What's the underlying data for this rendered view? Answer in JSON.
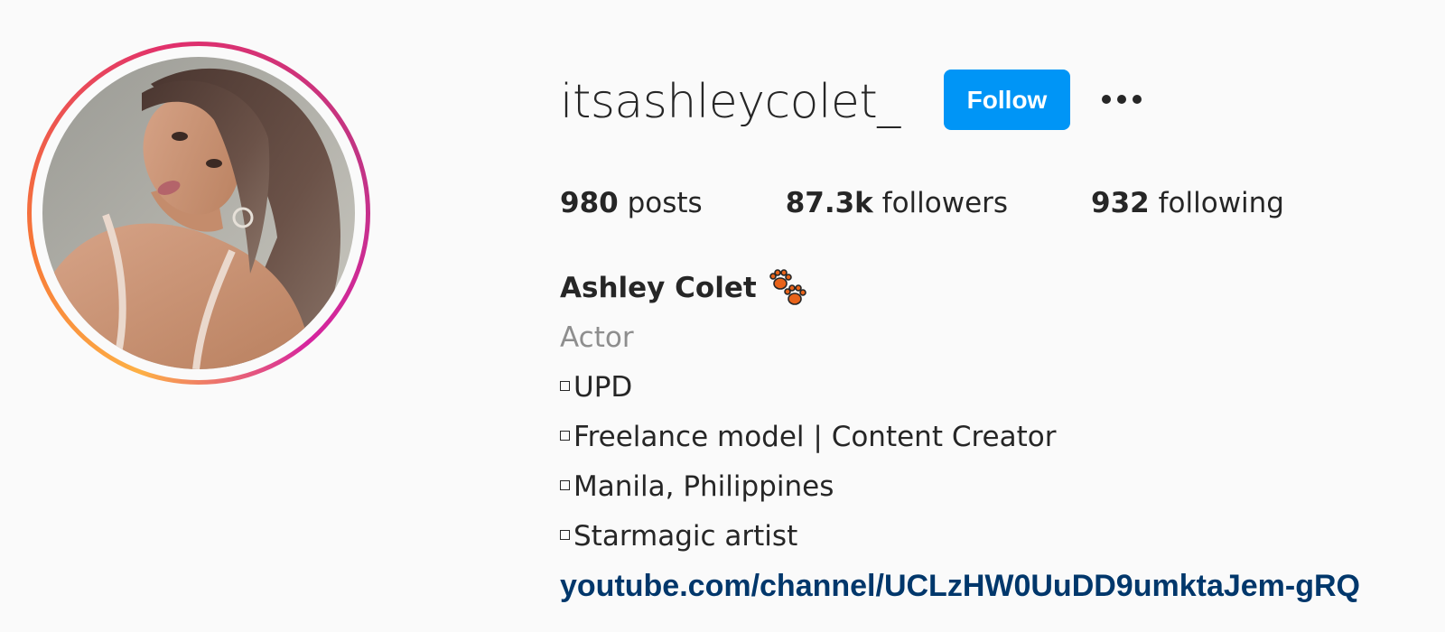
{
  "profile": {
    "username": "itsashleycolet_",
    "follow_label": "Follow",
    "more_icon": "more-options-icon",
    "avatar_icon": "profile-photo"
  },
  "stats": {
    "posts_count": "980",
    "posts_label": " posts",
    "followers_count": "87.3k",
    "followers_label": " followers",
    "following_count": "932",
    "following_label": " following"
  },
  "bio": {
    "full_name": "Ashley Colet",
    "name_emoji": "paw-prints-icon",
    "category": "Actor",
    "lines": [
      "UPD",
      "Freelance model | Content Creator",
      "Manila, Philippines",
      "Starmagic artist"
    ],
    "link": "youtube.com/channel/UCLzHW0UuDD9umktaJem-gRQ"
  },
  "colors": {
    "follow_button": "#0095f6",
    "link": "#00376b",
    "category": "#8e8e8e",
    "background": "#fafafa",
    "text": "#262626"
  }
}
